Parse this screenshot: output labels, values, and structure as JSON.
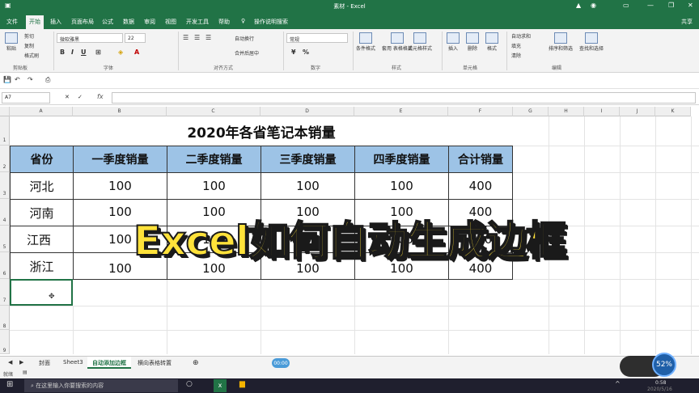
{
  "window": {
    "title": "素材 - Excel"
  },
  "menu": {
    "tabs": [
      "文件",
      "开始",
      "插入",
      "页面布局",
      "公式",
      "数据",
      "审阅",
      "视图",
      "开发工具",
      "帮助"
    ],
    "tell_me": "操作说明搜索",
    "share": "共享"
  },
  "ribbon": {
    "clipboard": {
      "cut": "剪切",
      "copy": "复制",
      "painter": "格式刷",
      "label": "剪贴板",
      "paste": "粘贴"
    },
    "font": {
      "name": "微软雅黑",
      "size": "22",
      "label": "字体"
    },
    "alignment": {
      "wrap": "自动换行",
      "merge": "合并后居中",
      "label": "对齐方式"
    },
    "number": {
      "format": "常规",
      "label": "数字"
    },
    "styles": {
      "conditional": "条件格式",
      "table": "套用\n表格格式",
      "cell": "单元格样式",
      "label": "样式"
    },
    "cells": {
      "insert": "插入",
      "delete": "删除",
      "format": "格式",
      "label": "单元格"
    },
    "editing": {
      "autosum": "自动求和",
      "fill": "填充",
      "clear": "清除",
      "sort": "排序和筛选",
      "find": "查找和选择",
      "label": "编辑"
    }
  },
  "formula_bar": {
    "name_box": "A7",
    "fx": "fx",
    "value": ""
  },
  "columns": [
    "A",
    "B",
    "C",
    "D",
    "E",
    "F",
    "G",
    "H",
    "I",
    "J",
    "K"
  ],
  "rows": [
    "1",
    "2",
    "3",
    "4",
    "5",
    "6",
    "7",
    "8",
    "9"
  ],
  "sheet": {
    "title": "2020年各省笔记本销量",
    "headers": [
      "省份",
      "一季度销量",
      "二季度销量",
      "三季度销量",
      "四季度销量",
      "合计销量"
    ],
    "data": [
      [
        "河北",
        "100",
        "100",
        "100",
        "100",
        "400"
      ],
      [
        "河南",
        "100",
        "100",
        "100",
        "100",
        "400"
      ],
      [
        "江西",
        "100",
        "100",
        "100",
        "100",
        "400"
      ],
      [
        "浙江",
        "100",
        "100",
        "100",
        "100",
        "400"
      ]
    ]
  },
  "overlay_caption": "Excel如何自动生成边框",
  "sheet_tabs": [
    "封面",
    "Sheet3",
    "自动添加边框",
    "横向表格转置"
  ],
  "active_sheet_tab": "自动添加边框",
  "status": {
    "ready": "就绪"
  },
  "video": {
    "time": "00:00",
    "percent": "52%"
  },
  "taskbar": {
    "search_placeholder": "在这里输入你要搜索的内容",
    "clock_time": "0:58",
    "clock_date": "2020/5/16"
  },
  "colors": {
    "excel_green": "#217346",
    "header_fill": "#9dc3e6",
    "caption_yellow": "#ffe23a"
  }
}
